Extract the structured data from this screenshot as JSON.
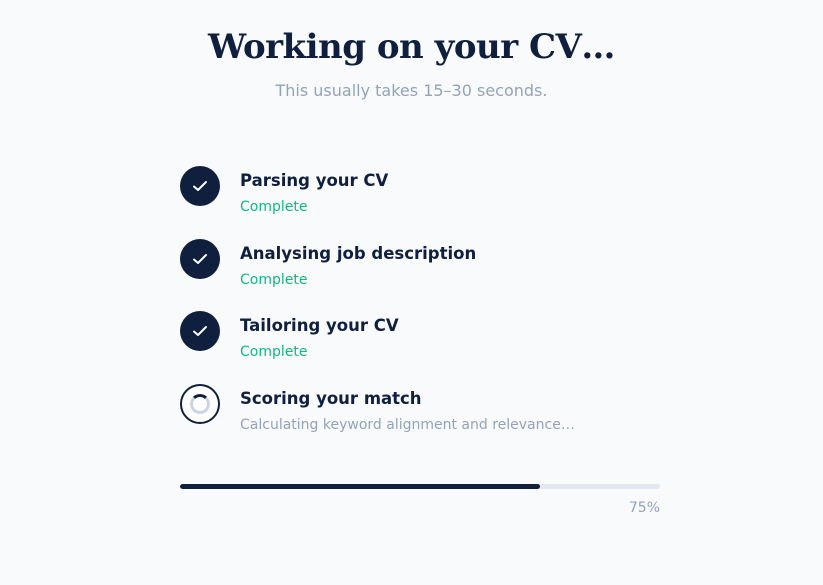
{
  "header": {
    "title": "Working on your CV…",
    "subtitle": "This usually takes 15–30 seconds."
  },
  "steps": [
    {
      "title": "Parsing your CV",
      "status": "Complete",
      "state": "done",
      "icon": "check-icon"
    },
    {
      "title": "Analysing job description",
      "status": "Complete",
      "state": "done",
      "icon": "check-icon"
    },
    {
      "title": "Tailoring your CV",
      "status": "Complete",
      "state": "done",
      "icon": "check-icon"
    },
    {
      "title": "Scoring your match",
      "status": "Calculating keyword alignment and relevance…",
      "state": "active",
      "icon": "spinner-icon"
    }
  ],
  "progress": {
    "value": 0.75,
    "label": "75%"
  },
  "colors": {
    "primary": "#0f1f3d",
    "success": "#10b981",
    "muted": "#94a3b8",
    "track": "#e2e8f0",
    "background": "#f8fafc"
  }
}
